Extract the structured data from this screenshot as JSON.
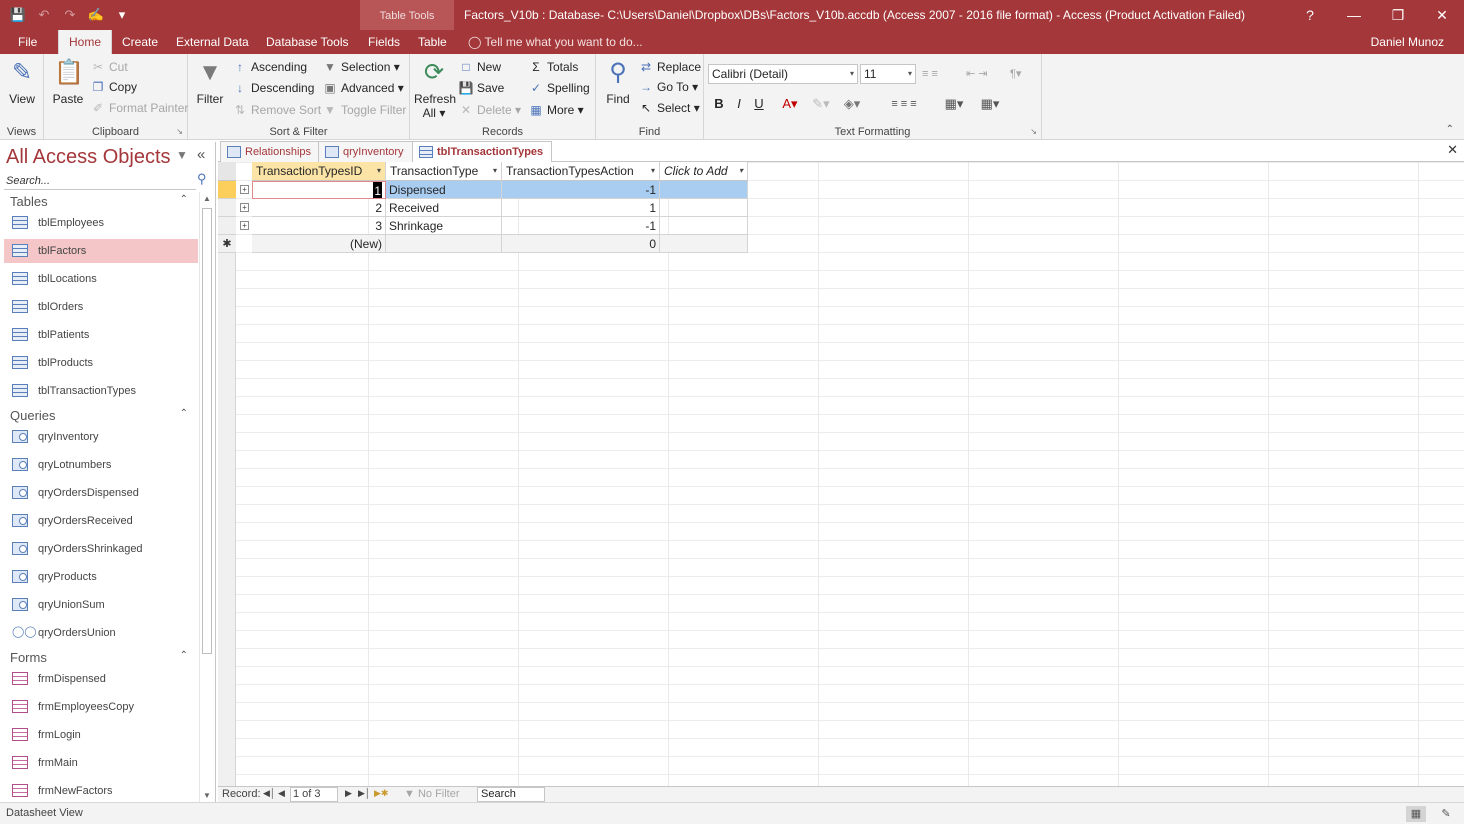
{
  "window": {
    "title": "Factors_V10b : Database- C:\\Users\\Daniel\\Dropbox\\DBs\\Factors_V10b.accdb (Access 2007 - 2016 file format) - Access (Product Activation Failed)",
    "context_group": "Table Tools",
    "buttons": [
      "?",
      "—",
      "❐",
      "✕"
    ]
  },
  "ribbon_tabs": [
    "File",
    "Home",
    "Create",
    "External Data",
    "Database Tools",
    "Fields",
    "Table"
  ],
  "active_tab": "Home",
  "tell_me": "Tell me what you want to do...",
  "user": "Daniel Munoz",
  "groups": {
    "views": {
      "name": "Views",
      "view": "View"
    },
    "clipboard": {
      "name": "Clipboard",
      "paste": "Paste",
      "cut": "Cut",
      "copy": "Copy",
      "format_painter": "Format Painter"
    },
    "sort_filter": {
      "name": "Sort & Filter",
      "filter": "Filter",
      "ascending": "Ascending",
      "descending": "Descending",
      "remove_sort": "Remove Sort",
      "selection": "Selection",
      "advanced": "Advanced",
      "toggle_filter": "Toggle Filter"
    },
    "records": {
      "name": "Records",
      "refresh": "Refresh",
      "refresh2": "All",
      "new": "New",
      "save": "Save",
      "delete": "Delete",
      "totals": "Totals",
      "spelling": "Spelling",
      "more": "More"
    },
    "find": {
      "name": "Find",
      "find": "Find",
      "replace": "Replace",
      "goto": "Go To",
      "select": "Select"
    },
    "text_formatting": {
      "name": "Text Formatting",
      "font": "Calibri (Detail)",
      "size": "11",
      "bold": "B",
      "italic": "I",
      "underline": "U"
    }
  },
  "nav": {
    "title": "All Access Objects",
    "search_placeholder": "Search...",
    "sections": [
      {
        "label": "Tables",
        "items": [
          "tblEmployees",
          "tblFactors",
          "tblLocations",
          "tblOrders",
          "tblPatients",
          "tblProducts",
          "tblTransactionTypes"
        ]
      },
      {
        "label": "Queries",
        "items": [
          "qryInventory",
          "qryLotnumbers",
          "qryOrdersDispensed",
          "qryOrdersReceived",
          "qryOrdersShrinkaged",
          "qryProducts",
          "qryUnionSum",
          "qryOrdersUnion"
        ]
      },
      {
        "label": "Forms",
        "items": [
          "frmDispensed",
          "frmEmployeesCopy",
          "frmLogin",
          "frmMain",
          "frmNewFactors"
        ]
      }
    ],
    "selected": "tblFactors"
  },
  "doc_tabs": [
    "Relationships",
    "qryInventory",
    "tblTransactionTypes"
  ],
  "active_doc": "tblTransactionTypes",
  "datasheet": {
    "columns": [
      "TransactionTypesID",
      "TransactionType",
      "TransactionTypesAction",
      "Click to Add"
    ],
    "rows": [
      {
        "id": "1",
        "type": "Dispensed",
        "action": "-1"
      },
      {
        "id": "2",
        "type": "Received",
        "action": "1"
      },
      {
        "id": "3",
        "type": "Shrinkage",
        "action": "-1"
      }
    ],
    "new_row": {
      "id": "(New)",
      "action": "0"
    }
  },
  "record_nav": {
    "label": "Record:",
    "position": "1 of 3",
    "filter": "No Filter",
    "search": "Search"
  },
  "status": {
    "text": "Datasheet View"
  },
  "colors": {
    "accent": "#a4373a",
    "selected_row": "#a9cdf1",
    "selected_header": "#fce4a6",
    "nav_selected": "#f4c6c7"
  }
}
